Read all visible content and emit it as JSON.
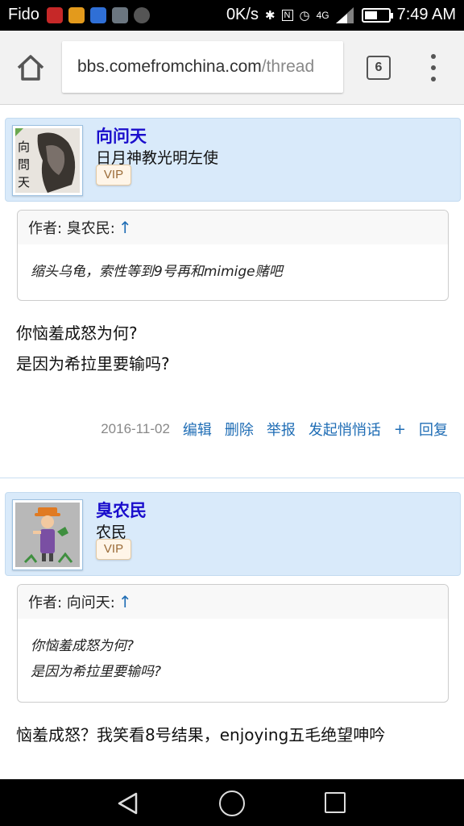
{
  "status_bar": {
    "carrier": "Fido",
    "net_speed": "0K/s",
    "network": "4G",
    "time": "7:49 AM",
    "battery_level": 0.55
  },
  "browser": {
    "url_domain": "bbs.comefromchina.com",
    "url_path": "/thread",
    "tab_count": "6"
  },
  "posts": [
    {
      "username": "向问天",
      "user_title": "日月神教光明左使",
      "vip": "VIP",
      "quote_author": "作者: 臭农民:",
      "quote_arrow": "↑",
      "quote_lines": [
        "缩头乌龟，索性等到9号再和mimige赌吧"
      ],
      "text_lines": [
        "你恼羞成怒为何?",
        "是因为希拉里要输吗?"
      ],
      "date": "2016-11-02",
      "actions": [
        "编辑",
        "删除",
        "举报",
        "发起悄悄话",
        "+",
        "回复"
      ]
    },
    {
      "username": "臭农民",
      "user_title": "农民",
      "vip": "VIP",
      "quote_author": "作者: 向问天:",
      "quote_arrow": "↑",
      "quote_lines": [
        "你恼羞成怒为何?",
        "是因为希拉里要输吗?"
      ],
      "text_lines": [
        "恼羞成怒？我笑看8号结果，enjoying五毛绝望呻吟"
      ]
    }
  ]
}
